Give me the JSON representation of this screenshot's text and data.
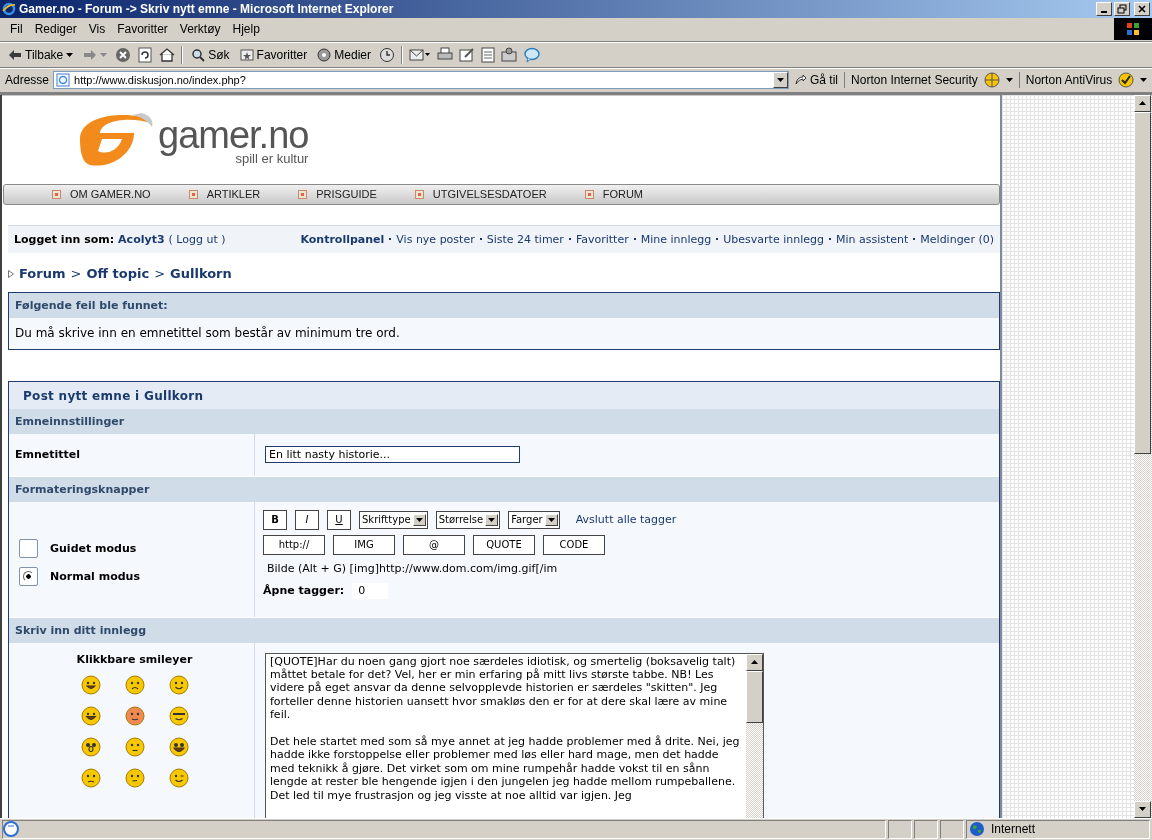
{
  "window": {
    "title": "Gamer.no - Forum -> Skriv nytt emne - Microsoft Internet Explorer"
  },
  "menu": [
    "Fil",
    "Rediger",
    "Vis",
    "Favoritter",
    "Verktøy",
    "Hjelp"
  ],
  "toolbar": {
    "back": "Tilbake",
    "search": "Søk",
    "favorites": "Favoritter",
    "media": "Medier"
  },
  "address_bar": {
    "label": "Adresse",
    "url": "http://www.diskusjon.no/index.php?",
    "go": "Gå til",
    "norton_security": "Norton Internet Security",
    "norton_antivirus": "Norton AntiVirus"
  },
  "logo": {
    "name": "gamer.no",
    "tagline": "spill er kultur"
  },
  "nav": [
    "OM GAMER.NO",
    "ARTIKLER",
    "PRISGUIDE",
    "UTGIVELSESDATOER",
    "FORUM"
  ],
  "user_bar": {
    "label": "Logget inn som:",
    "user": "Acolyt3",
    "logout": "( Logg ut )",
    "links": [
      {
        "label": "Kontrollpanel",
        "emphasized": true
      },
      {
        "label": "Vis nye poster",
        "emphasized": false
      },
      {
        "label": "Siste 24 timer",
        "emphasized": false
      },
      {
        "label": "Favoritter",
        "emphasized": false
      },
      {
        "label": "Mine innlegg",
        "emphasized": false
      },
      {
        "label": "Ubesvarte innlegg",
        "emphasized": false
      },
      {
        "label": "Min assistent",
        "emphasized": false
      },
      {
        "label": "Meldinger (0)",
        "emphasized": false
      }
    ]
  },
  "breadcrumb": {
    "separator": ">",
    "items": [
      "Forum",
      "Off topic",
      "Gullkorn"
    ]
  },
  "error": {
    "title": "Følgende feil ble funnet:",
    "message": "Du må skrive inn en emnetittel som består av minimum tre ord."
  },
  "post_form": {
    "title": "Post nytt emne i Gullkorn",
    "settings_header": "Emneinnstillinger",
    "subject_label": "Emnetittel",
    "subject_value": "En litt nasty historie...",
    "format_header": "Formateringsknapper",
    "modes": [
      {
        "label": "Guidet modus",
        "selected": false
      },
      {
        "label": "Normal modus",
        "selected": true
      }
    ],
    "style_buttons": [
      {
        "label": "B",
        "kind": "bold"
      },
      {
        "label": "I",
        "kind": "italic"
      },
      {
        "label": "U",
        "kind": "underline"
      }
    ],
    "selects": [
      "Skrifttype",
      "Størrelse",
      "Farger"
    ],
    "close_tags": "Avslutt alle tagger",
    "tag_buttons": [
      "http://",
      "IMG",
      "@",
      "QUOTE",
      "CODE"
    ],
    "help_text": "Bilde (Alt + G) [img]http://www.dom.com/img.gif[/im",
    "open_tags_label": "Åpne tagger:",
    "open_tags_value": "0",
    "message_header": "Skriv inn ditt innlegg",
    "smileys_title": "Klikkbare smileyer",
    "smileys": [
      {
        "kind": "grin"
      },
      {
        "kind": "sad"
      },
      {
        "kind": "smile"
      },
      {
        "kind": "laugh"
      },
      {
        "kind": "blush"
      },
      {
        "kind": "cool"
      },
      {
        "kind": "shock"
      },
      {
        "kind": "neutral"
      },
      {
        "kind": "crazy"
      },
      {
        "kind": "dizzy"
      },
      {
        "kind": "think"
      },
      {
        "kind": "wink"
      }
    ],
    "message": [
      "[QUOTE]Har du noen gang gjort noe særdeles idiotisk, og smertelig (boksavelig talt) måttet betale for det? Vel, her er min erfaring på mitt livs største tabbe. NB! Les videre på eget ansvar da denne selvopplevde historien er særdeles \"skitten\". Jeg forteller denne historien uansett hvor smakløs den er for at dere skal lære av mine feil.",
      "Det hele startet med som så mye annet at jeg hadde problemer med å drite. Nei, jeg hadde ikke forstoppelse eller problemer med løs eller hard mage, men det hadde med teknikk å gjøre. Det virket som om mine rumpehår hadde vokst til en sånn lengde at rester ble hengende igjen i den jungelen jeg hadde mellom rumpeballene. Det led til mye frustrasjon og jeg visste at noe alltid var igjen. Jeg"
    ]
  },
  "status_bar": {
    "zone": "Internett"
  }
}
